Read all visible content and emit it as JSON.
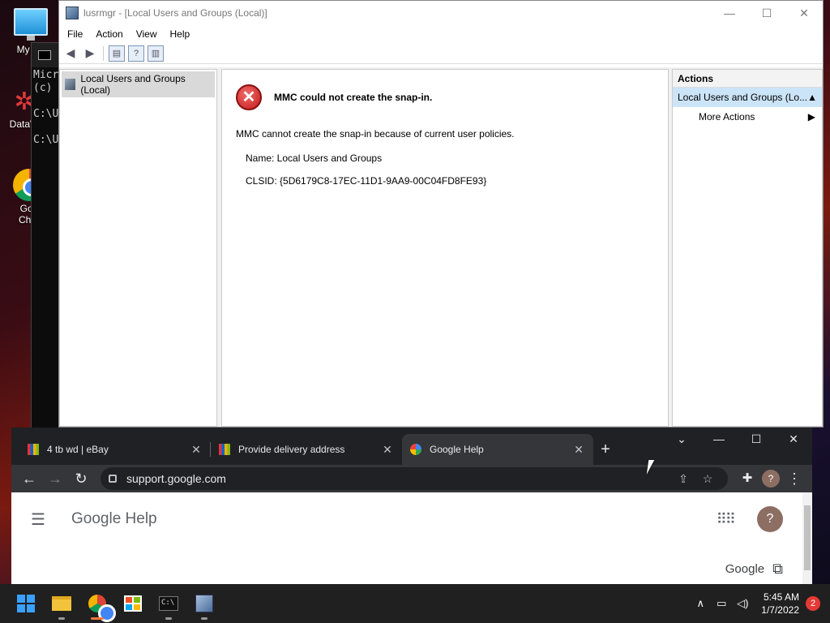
{
  "desktop": {
    "icons": [
      {
        "label": "My Co",
        "icon": "computer-icon"
      },
      {
        "label": "DataW",
        "icon": "datawrapper-icon"
      },
      {
        "label": "Goo Chro",
        "icon": "chrome-icon"
      }
    ]
  },
  "console": {
    "lines": "Micr\n(c)\n\nC:\\U\n\nC:\\U"
  },
  "mmc": {
    "title": "lusrmgr - [Local Users and Groups (Local)]",
    "window_buttons": {
      "minimize": "—",
      "maximize": "☐",
      "close": "✕"
    },
    "menu": [
      "File",
      "Action",
      "View",
      "Help"
    ],
    "toolbar_icons": [
      "back-icon",
      "forward-icon",
      "show-hide-tree-icon",
      "help-icon",
      "show-hide-action-pane-icon"
    ],
    "tree": {
      "item": "Local Users and Groups (Local)"
    },
    "error": {
      "title": "MMC could not create the snap-in.",
      "message": "MMC cannot create the snap-in because of current user policies.",
      "name_line": "Name: Local Users and Groups",
      "clsid_line": "CLSID: {5D6179C8-17EC-11D1-9AA9-00C04FD8FE93}"
    },
    "actions": {
      "header": "Actions",
      "selected": "Local Users and Groups (Lo...",
      "more": "More Actions"
    }
  },
  "chrome": {
    "tabs": [
      {
        "title": "4 tb wd | eBay",
        "favicon": "ebay-favicon",
        "active": false
      },
      {
        "title": "Provide delivery address",
        "favicon": "ebay-favicon",
        "active": false
      },
      {
        "title": "Google Help",
        "favicon": "google-favicon",
        "active": true
      }
    ],
    "new_tab": "+",
    "url": "support.google.com",
    "profile_initial": "?",
    "page": {
      "title": "Google Help",
      "avatar_initial": "?",
      "google_link": "Google"
    }
  },
  "taskbar": {
    "apps": [
      "start-icon",
      "file-explorer-icon",
      "chrome-icon",
      "store-icon",
      "terminal-icon",
      "mmc-icon"
    ],
    "time": "5:45 AM",
    "date": "1/7/2022",
    "notifications": "2"
  }
}
